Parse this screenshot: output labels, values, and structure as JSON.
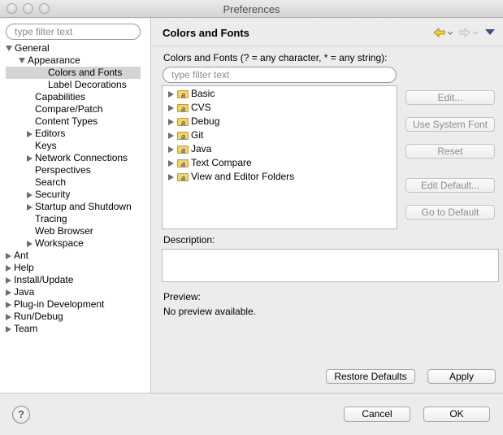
{
  "window": {
    "title": "Preferences"
  },
  "left": {
    "filter_placeholder": "type filter text",
    "tree": [
      {
        "label": "General",
        "expanded": true
      },
      {
        "label": "Appearance",
        "expanded": true
      },
      {
        "label": "Colors and Fonts",
        "selected": true
      },
      {
        "label": "Label Decorations"
      },
      {
        "label": "Capabilities"
      },
      {
        "label": "Compare/Patch"
      },
      {
        "label": "Content Types"
      },
      {
        "label": "Editors",
        "expandable": true
      },
      {
        "label": "Keys"
      },
      {
        "label": "Network Connections",
        "expandable": true
      },
      {
        "label": "Perspectives"
      },
      {
        "label": "Search"
      },
      {
        "label": "Security",
        "expandable": true
      },
      {
        "label": "Startup and Shutdown",
        "expandable": true
      },
      {
        "label": "Tracing"
      },
      {
        "label": "Web Browser"
      },
      {
        "label": "Workspace",
        "expandable": true
      },
      {
        "label": "Ant",
        "expandable": true
      },
      {
        "label": "Help",
        "expandable": true
      },
      {
        "label": "Install/Update",
        "expandable": true
      },
      {
        "label": "Java",
        "expandable": true
      },
      {
        "label": "Plug-in Development",
        "expandable": true
      },
      {
        "label": "Run/Debug",
        "expandable": true
      },
      {
        "label": "Team",
        "expandable": true
      }
    ]
  },
  "page": {
    "title": "Colors and Fonts",
    "filter_label": "Colors and Fonts (? = any character, * = any string):",
    "filter_placeholder": "type filter text",
    "categories": [
      "Basic",
      "CVS",
      "Debug",
      "Git",
      "Java",
      "Text Compare",
      "View and Editor Folders"
    ],
    "buttons": {
      "edit": "Edit...",
      "use_system_font": "Use System Font",
      "reset": "Reset",
      "edit_default": "Edit Default...",
      "go_to_default": "Go to Default",
      "restore_defaults": "Restore Defaults",
      "apply": "Apply"
    },
    "description_label": "Description:",
    "preview_label": "Preview:",
    "preview_text": "No preview available."
  },
  "footer": {
    "help": "?",
    "cancel": "Cancel",
    "ok": "OK"
  },
  "icons": {
    "back": "back-arrow-icon",
    "forward": "forward-arrow-icon",
    "menu": "view-menu-icon",
    "folder": "folder-icon"
  },
  "colors": {
    "selection": "#d4d4d4",
    "folder": "#f3d26a",
    "nav_arrow": "#e2b93b"
  }
}
